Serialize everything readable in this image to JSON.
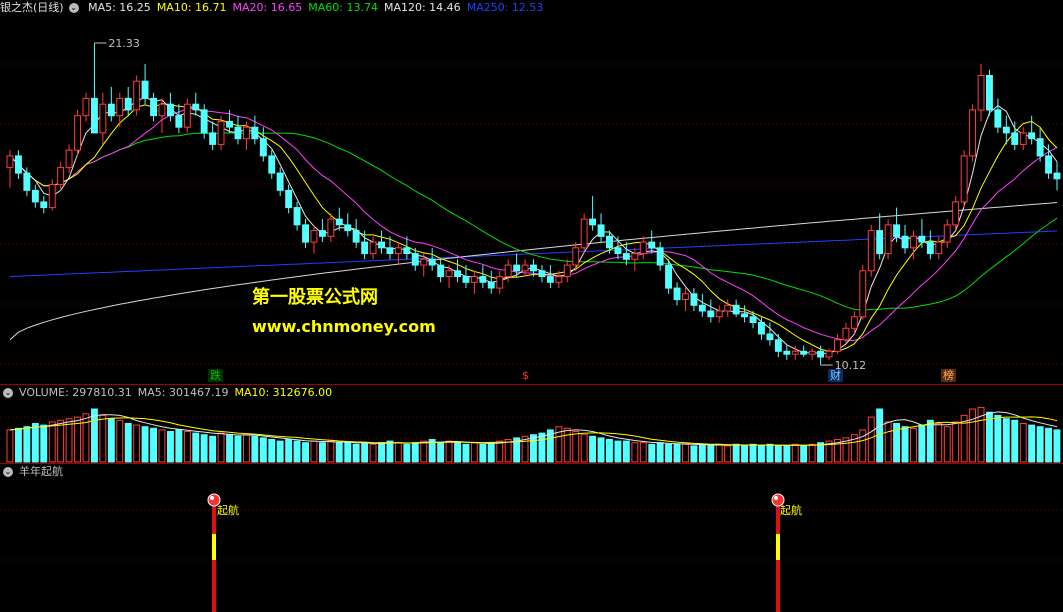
{
  "colors": {
    "up": "#ff3c3c",
    "down": "#54ffff",
    "ma5": "#e6e6e6",
    "ma10": "#ffff00",
    "ma20": "#ff40ff",
    "ma60": "#00e000",
    "ma120": "#d8d8d8",
    "ma250": "#2040ff",
    "grid": "#6b0000",
    "sep": "#a00000"
  },
  "main_panel": {
    "title": "银之杰(日线)",
    "legend": [
      {
        "label": "MA5: 16.25",
        "color": "#e6e6e6"
      },
      {
        "label": "MA10: 16.71",
        "color": "#ffff00"
      },
      {
        "label": "MA20: 16.65",
        "color": "#ff40ff"
      },
      {
        "label": "MA60: 13.74",
        "color": "#00e000"
      },
      {
        "label": "MA120: 14.46",
        "color": "#e6e6e6"
      },
      {
        "label": "MA250: 12.53",
        "color": "#2040ff"
      }
    ],
    "high_label": "21.33",
    "low_label": "10.12",
    "markers": [
      {
        "text": "跌",
        "color": "#00c000",
        "bg": "#003000"
      },
      {
        "text": "$",
        "color": "#ff3030",
        "bg": "transparent"
      },
      {
        "text": "财",
        "color": "#7fd0ff",
        "bg": "#0a2a60"
      },
      {
        "text": "榜",
        "color": "#ffb060",
        "bg": "#5a2a10"
      }
    ]
  },
  "watermark": {
    "line1": "第一股票公式网",
    "line2": "www.chnmoney.com"
  },
  "volume_panel": {
    "legend": [
      {
        "label": "VOLUME: 297810.31",
        "color": "#c0c0c0"
      },
      {
        "label": "MA5: 301467.19",
        "color": "#c0c0c0"
      },
      {
        "label": "MA10: 312676.00",
        "color": "#ffff00"
      }
    ]
  },
  "indicator_panel": {
    "title": "羊年起航",
    "signals": [
      {
        "label": "起航"
      },
      {
        "label": "起航"
      }
    ]
  },
  "chart_data": {
    "type": "candlestick",
    "title": "银之杰(日线)",
    "price_range": [
      10.12,
      21.33
    ],
    "candles": [
      [
        17.0,
        17.6,
        16.3,
        17.4
      ],
      [
        17.4,
        17.6,
        16.6,
        16.8
      ],
      [
        16.8,
        17.0,
        16.0,
        16.2
      ],
      [
        16.2,
        16.4,
        15.6,
        15.8
      ],
      [
        15.8,
        16.0,
        15.4,
        15.6
      ],
      [
        15.6,
        16.6,
        15.5,
        16.4
      ],
      [
        16.4,
        17.2,
        16.2,
        17.0
      ],
      [
        17.0,
        17.8,
        16.8,
        17.6
      ],
      [
        17.6,
        19.0,
        17.4,
        18.8
      ],
      [
        18.8,
        19.6,
        18.6,
        19.4
      ],
      [
        19.4,
        21.33,
        19.0,
        18.2
      ],
      [
        18.2,
        19.6,
        17.8,
        19.2
      ],
      [
        19.2,
        19.8,
        18.6,
        18.8
      ],
      [
        18.8,
        19.6,
        18.4,
        19.4
      ],
      [
        19.4,
        19.8,
        18.8,
        19.0
      ],
      [
        19.0,
        20.2,
        18.8,
        20.0
      ],
      [
        20.0,
        20.6,
        19.2,
        19.4
      ],
      [
        19.4,
        19.6,
        18.6,
        18.8
      ],
      [
        18.8,
        19.4,
        18.2,
        19.2
      ],
      [
        19.2,
        19.6,
        18.6,
        18.8
      ],
      [
        18.8,
        19.2,
        18.2,
        18.4
      ],
      [
        18.4,
        19.4,
        18.2,
        19.2
      ],
      [
        19.2,
        19.6,
        18.8,
        19.0
      ],
      [
        19.0,
        19.2,
        18.0,
        18.2
      ],
      [
        18.2,
        18.6,
        17.6,
        17.8
      ],
      [
        17.8,
        18.8,
        17.6,
        18.6
      ],
      [
        18.6,
        19.0,
        18.2,
        18.4
      ],
      [
        18.4,
        18.8,
        17.8,
        18.0
      ],
      [
        18.0,
        18.6,
        17.6,
        18.4
      ],
      [
        18.4,
        18.8,
        17.8,
        18.0
      ],
      [
        18.0,
        18.4,
        17.2,
        17.4
      ],
      [
        17.4,
        17.6,
        16.6,
        16.8
      ],
      [
        16.8,
        17.0,
        16.0,
        16.2
      ],
      [
        16.2,
        16.4,
        15.4,
        15.6
      ],
      [
        15.6,
        15.8,
        14.8,
        15.0
      ],
      [
        15.0,
        15.2,
        14.2,
        14.4
      ],
      [
        14.4,
        15.0,
        14.0,
        14.8
      ],
      [
        14.8,
        15.2,
        14.4,
        14.6
      ],
      [
        14.6,
        15.4,
        14.4,
        15.2
      ],
      [
        15.2,
        15.6,
        14.8,
        15.0
      ],
      [
        15.0,
        15.4,
        14.6,
        14.8
      ],
      [
        14.8,
        15.2,
        14.2,
        14.4
      ],
      [
        14.4,
        14.8,
        13.8,
        14.0
      ],
      [
        14.0,
        14.6,
        13.8,
        14.4
      ],
      [
        14.4,
        14.8,
        14.0,
        14.2
      ],
      [
        14.2,
        14.6,
        13.8,
        14.0
      ],
      [
        14.0,
        14.4,
        13.6,
        14.2
      ],
      [
        14.2,
        14.6,
        13.8,
        14.0
      ],
      [
        14.0,
        14.2,
        13.4,
        13.6
      ],
      [
        13.6,
        14.0,
        13.2,
        13.8
      ],
      [
        13.8,
        14.2,
        13.4,
        13.6
      ],
      [
        13.6,
        13.8,
        13.0,
        13.2
      ],
      [
        13.2,
        13.6,
        12.8,
        13.4
      ],
      [
        13.4,
        13.8,
        13.0,
        13.2
      ],
      [
        13.2,
        13.6,
        12.8,
        13.0
      ],
      [
        13.0,
        13.4,
        12.6,
        13.2
      ],
      [
        13.2,
        13.6,
        12.8,
        13.0
      ],
      [
        13.0,
        13.4,
        12.6,
        12.8
      ],
      [
        12.8,
        13.4,
        12.6,
        13.2
      ],
      [
        13.2,
        13.8,
        13.0,
        13.6
      ],
      [
        13.6,
        14.0,
        13.2,
        13.4
      ],
      [
        13.4,
        13.8,
        13.2,
        13.6
      ],
      [
        13.6,
        13.8,
        13.2,
        13.4
      ],
      [
        13.4,
        13.6,
        13.0,
        13.2
      ],
      [
        13.2,
        13.6,
        12.8,
        13.0
      ],
      [
        13.0,
        13.4,
        12.8,
        13.2
      ],
      [
        13.2,
        13.8,
        13.0,
        13.6
      ],
      [
        13.6,
        14.4,
        13.4,
        14.2
      ],
      [
        14.2,
        15.4,
        14.0,
        15.2
      ],
      [
        15.2,
        16.0,
        14.8,
        15.0
      ],
      [
        15.0,
        15.4,
        14.4,
        14.6
      ],
      [
        14.6,
        14.8,
        14.0,
        14.2
      ],
      [
        14.2,
        14.6,
        13.8,
        14.0
      ],
      [
        14.0,
        14.4,
        13.6,
        13.8
      ],
      [
        13.8,
        14.2,
        13.4,
        14.0
      ],
      [
        14.0,
        14.6,
        13.8,
        14.4
      ],
      [
        14.4,
        14.8,
        14.0,
        14.2
      ],
      [
        14.2,
        14.4,
        13.4,
        13.6
      ],
      [
        13.6,
        13.8,
        12.6,
        12.8
      ],
      [
        12.8,
        13.0,
        12.2,
        12.4
      ],
      [
        12.4,
        12.8,
        12.0,
        12.6
      ],
      [
        12.6,
        12.8,
        12.0,
        12.2
      ],
      [
        12.2,
        12.6,
        11.8,
        12.0
      ],
      [
        12.0,
        12.4,
        11.6,
        11.8
      ],
      [
        11.8,
        12.2,
        11.6,
        12.0
      ],
      [
        12.0,
        12.4,
        11.8,
        12.2
      ],
      [
        12.2,
        12.4,
        11.8,
        11.9
      ],
      [
        11.9,
        12.2,
        11.6,
        11.8
      ],
      [
        11.8,
        12.0,
        11.4,
        11.6
      ],
      [
        11.6,
        11.8,
        11.0,
        11.2
      ],
      [
        11.2,
        11.6,
        10.8,
        11.0
      ],
      [
        11.0,
        11.2,
        10.4,
        10.6
      ],
      [
        10.6,
        10.8,
        10.3,
        10.5
      ],
      [
        10.5,
        10.8,
        10.3,
        10.6
      ],
      [
        10.6,
        10.8,
        10.4,
        10.5
      ],
      [
        10.5,
        10.7,
        10.3,
        10.6
      ],
      [
        10.6,
        10.8,
        10.12,
        10.4
      ],
      [
        10.4,
        10.7,
        10.3,
        10.6
      ],
      [
        10.6,
        11.2,
        10.5,
        11.0
      ],
      [
        11.0,
        11.6,
        10.9,
        11.4
      ],
      [
        11.4,
        12.0,
        11.2,
        11.8
      ],
      [
        11.8,
        13.6,
        11.7,
        13.4
      ],
      [
        13.4,
        15.0,
        13.2,
        14.8
      ],
      [
        14.8,
        15.4,
        13.8,
        14.0
      ],
      [
        14.0,
        15.2,
        13.8,
        15.0
      ],
      [
        15.0,
        15.6,
        14.4,
        14.6
      ],
      [
        14.6,
        15.0,
        14.0,
        14.2
      ],
      [
        14.2,
        14.8,
        13.8,
        14.6
      ],
      [
        14.6,
        15.2,
        14.2,
        14.4
      ],
      [
        14.4,
        14.8,
        13.8,
        14.0
      ],
      [
        14.0,
        14.6,
        13.8,
        14.4
      ],
      [
        14.4,
        15.2,
        14.2,
        15.0
      ],
      [
        15.0,
        16.0,
        14.8,
        15.8
      ],
      [
        15.8,
        17.6,
        15.6,
        17.4
      ],
      [
        17.4,
        19.2,
        17.2,
        19.0
      ],
      [
        19.0,
        20.6,
        18.6,
        20.2
      ],
      [
        20.2,
        20.4,
        18.8,
        19.0
      ],
      [
        19.0,
        19.4,
        18.2,
        18.4
      ],
      [
        18.4,
        18.8,
        17.8,
        18.2
      ],
      [
        18.2,
        18.6,
        17.6,
        17.8
      ],
      [
        17.8,
        18.4,
        17.6,
        18.2
      ],
      [
        18.2,
        18.8,
        17.8,
        18.0
      ],
      [
        18.0,
        18.4,
        17.2,
        17.4
      ],
      [
        17.4,
        17.8,
        16.6,
        16.8
      ],
      [
        16.8,
        17.2,
        16.2,
        16.6
      ]
    ],
    "volume": [
      20,
      21,
      22,
      24,
      23,
      25,
      26,
      27,
      28,
      30,
      33,
      29,
      27,
      26,
      24,
      23,
      22,
      21,
      20,
      19,
      20,
      19,
      18,
      17,
      16,
      18,
      17,
      16,
      17,
      16,
      15,
      14,
      13,
      14,
      13,
      12,
      13,
      12,
      13,
      12,
      12,
      11,
      12,
      11,
      12,
      13,
      12,
      11,
      12,
      13,
      14,
      12,
      13,
      12,
      11,
      12,
      11,
      12,
      13,
      14,
      15,
      16,
      17,
      18,
      20,
      22,
      21,
      19,
      17,
      16,
      15,
      14,
      13,
      13,
      12,
      12,
      11,
      12,
      11,
      11,
      11,
      10,
      11,
      10,
      11,
      10,
      11,
      10,
      11,
      10,
      11,
      10,
      10,
      11,
      10,
      11,
      12,
      13,
      14,
      15,
      17,
      20,
      28,
      33,
      25,
      24,
      22,
      21,
      23,
      26,
      24,
      22,
      25,
      29,
      33,
      34,
      31,
      29,
      27,
      26,
      24,
      23,
      22,
      21,
      20
    ],
    "volume_labels": {
      "VOLUME": 297810.31,
      "MA5": 301467.19,
      "MA10": 312676.0
    },
    "ma_labels": {
      "MA5": 16.25,
      "MA10": 16.71,
      "MA20": 16.65,
      "MA60": 13.74,
      "MA120": 14.46,
      "MA250": 12.53
    },
    "signals": [
      "起航",
      "起航"
    ]
  }
}
